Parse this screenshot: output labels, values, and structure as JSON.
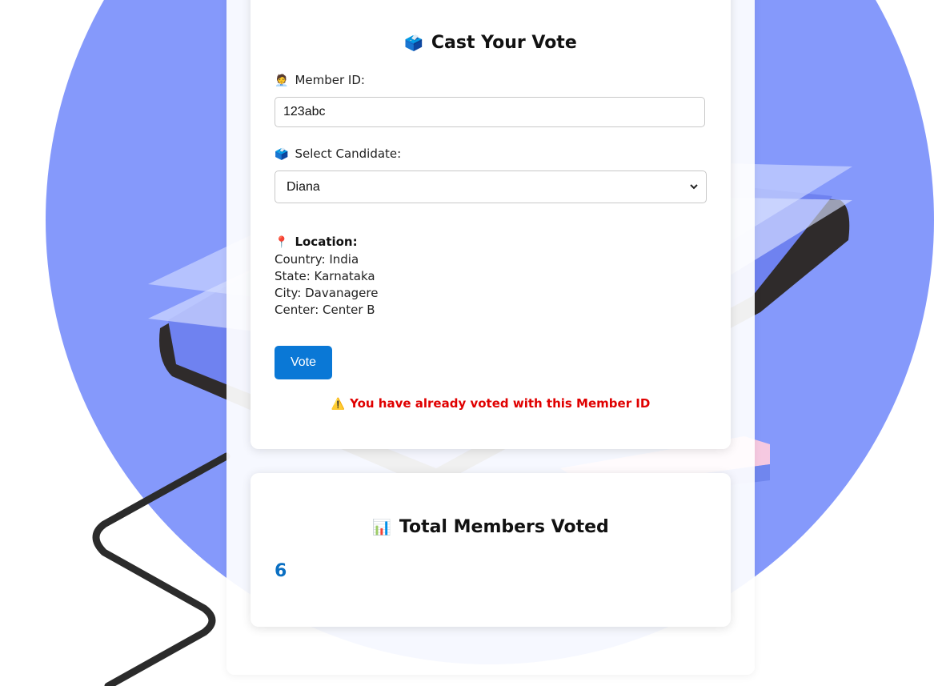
{
  "vote_form": {
    "title": "Cast Your Vote",
    "title_icon": "ballot-box-icon",
    "member_id_label": "Member ID:",
    "member_id_icon": "person-icon",
    "member_id_value": "123abc",
    "candidate_label": "Select Candidate:",
    "candidate_icon": "ballot-box-icon",
    "candidate_selected": "Diana",
    "location": {
      "heading": "Location:",
      "icon": "pushpin-icon",
      "country": "Country: India",
      "state": "State: Karnataka",
      "city": "City: Davanagere",
      "center": "Center: Center B"
    },
    "vote_button_label": "Vote",
    "warning_icon": "warning-icon",
    "warning_text": "You have already voted with this Member ID"
  },
  "totals": {
    "title": "Total Members Voted",
    "title_icon": "bar-chart-icon",
    "count": "6"
  },
  "colors": {
    "accent": "#0a78d6",
    "count_text": "#0a6fc2",
    "warning": "#e00000",
    "background_circle": "#8599fb"
  }
}
